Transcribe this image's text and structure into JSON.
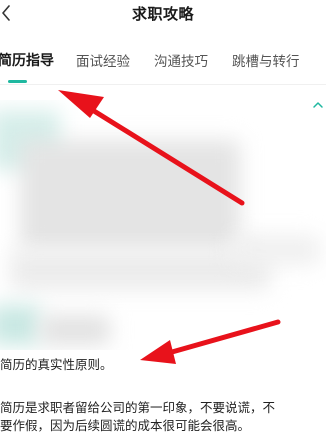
{
  "header": {
    "title": "求职攻略",
    "back_icon": "chevron-left-icon"
  },
  "tabs": [
    {
      "label": "简历指导",
      "active": true
    },
    {
      "label": "面试经验",
      "active": false
    },
    {
      "label": "沟通技巧",
      "active": false
    },
    {
      "label": "跳槽与转行",
      "active": false
    }
  ],
  "accent_color": "#1fb8a0",
  "annotation_color": "#e8121b",
  "article": {
    "heading": "简历的真实性原则。",
    "paragraph_line1": "简历是求职者留给公司的第一印象，不要说谎，不",
    "paragraph_line2": "要作假，因为后续圆谎的成本很可能会很高。"
  }
}
